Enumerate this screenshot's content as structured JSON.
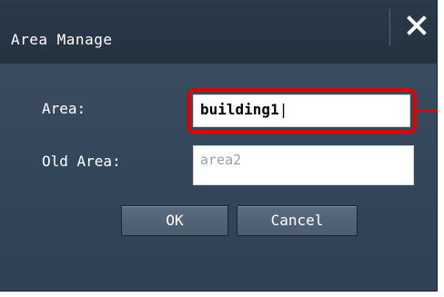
{
  "dialog": {
    "title": "Area Manage",
    "close_icon": "close-icon"
  },
  "form": {
    "area_label": "Area:",
    "area_value": "building1",
    "old_area_label": "Old Area:",
    "old_area_value": "area2"
  },
  "buttons": {
    "ok_label": "OK",
    "cancel_label": "Cancel"
  },
  "colors": {
    "dialog_bg": "#34465a",
    "titlebar_bg": "#24323f",
    "highlight": "#e00000",
    "button_bg": "#4a5b6e"
  }
}
